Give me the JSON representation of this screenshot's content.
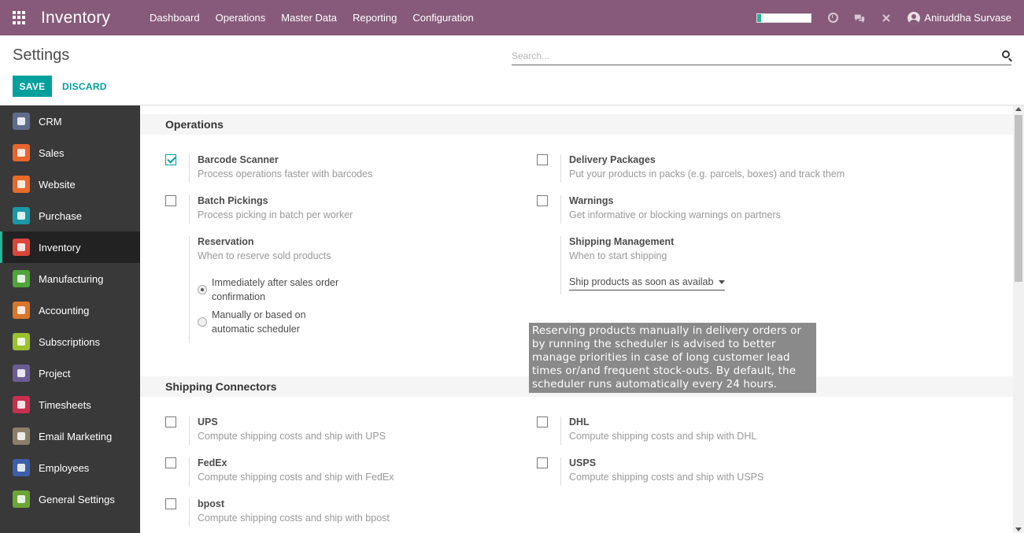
{
  "navbar": {
    "brand": "Inventory",
    "menu": [
      "Dashboard",
      "Operations",
      "Master Data",
      "Reporting",
      "Configuration"
    ],
    "progress_percent": 6,
    "user_name": "Aniruddha Survase",
    "colors": {
      "background": "#875a7b",
      "progress": "#21b799"
    },
    "icons": [
      "apps-grid-icon",
      "clock-icon",
      "chat-icon",
      "close-icon",
      "user-avatar-icon"
    ]
  },
  "control": {
    "title": "Settings",
    "search_placeholder": "Search...",
    "save_label": "SAVE",
    "discard_label": "DISCARD",
    "accent": "#00a09d"
  },
  "sidebar": {
    "items": [
      {
        "label": "CRM",
        "icon": "handshake-icon",
        "color": "#5f6b8a"
      },
      {
        "label": "Sales",
        "icon": "chart-line-icon",
        "color": "#e8652e"
      },
      {
        "label": "Website",
        "icon": "globe-icon",
        "color": "#e86a2b"
      },
      {
        "label": "Purchase",
        "icon": "credit-card-icon",
        "color": "#1a98a6"
      },
      {
        "label": "Inventory",
        "icon": "box-icon",
        "color": "#d9463a",
        "active": true
      },
      {
        "label": "Manufacturing",
        "icon": "wrench-icon",
        "color": "#4fa43a"
      },
      {
        "label": "Accounting",
        "icon": "document-icon",
        "color": "#d9762a"
      },
      {
        "label": "Subscriptions",
        "icon": "rss-icon",
        "color": "#9bc12c"
      },
      {
        "label": "Project",
        "icon": "puzzle-icon",
        "color": "#6b5d93"
      },
      {
        "label": "Timesheets",
        "icon": "clock-icon",
        "color": "#c7304e"
      },
      {
        "label": "Email Marketing",
        "icon": "paper-plane-icon",
        "color": "#8c7f6a"
      },
      {
        "label": "Employees",
        "icon": "users-icon",
        "color": "#3d5fa8"
      },
      {
        "label": "General Settings",
        "icon": "gear-icon",
        "color": "#6aa536"
      }
    ]
  },
  "operations": {
    "title": "Operations",
    "barcode": {
      "title": "Barcode Scanner",
      "desc": "Process operations faster with barcodes",
      "checked": true
    },
    "delivery": {
      "title": "Delivery Packages",
      "desc": "Put your products in packs (e.g. parcels, boxes) and track them",
      "checked": false
    },
    "batch": {
      "title": "Batch Pickings",
      "desc": "Process picking in batch per worker",
      "checked": false
    },
    "warnings": {
      "title": "Warnings",
      "desc": "Get informative or blocking warnings on partners",
      "checked": false
    },
    "reservation": {
      "title": "Reservation",
      "desc": "When to reserve sold products",
      "option1_line1": "Immediately after sales order",
      "option1_line2": "confirmation",
      "option2_line1": "Manually or based on",
      "option2_line2": "automatic scheduler",
      "selected": "option1"
    },
    "shipping_mgmt": {
      "title": "Shipping Management",
      "desc": "When to start shipping",
      "select_value": "Ship products as soon as availab"
    }
  },
  "tooltip": {
    "text": "Reserving products manually in delivery orders or by running the scheduler is advised to better manage priorities in case of long customer lead times or/and frequent stock-outs. By default, the scheduler runs automatically every 24 hours."
  },
  "connectors": {
    "title": "Shipping Connectors",
    "ups": {
      "title": "UPS",
      "desc": "Compute shipping costs and ship with UPS",
      "checked": false
    },
    "dhl": {
      "title": "DHL",
      "desc": "Compute shipping costs and ship with DHL",
      "checked": false
    },
    "fedex": {
      "title": "FedEx",
      "desc": "Compute shipping costs and ship with FedEx",
      "checked": false
    },
    "usps": {
      "title": "USPS",
      "desc": "Compute shipping costs and ship with USPS",
      "checked": false
    },
    "bpost": {
      "title": "bpost",
      "desc": "Compute shipping costs and ship with bpost",
      "checked": false
    }
  }
}
